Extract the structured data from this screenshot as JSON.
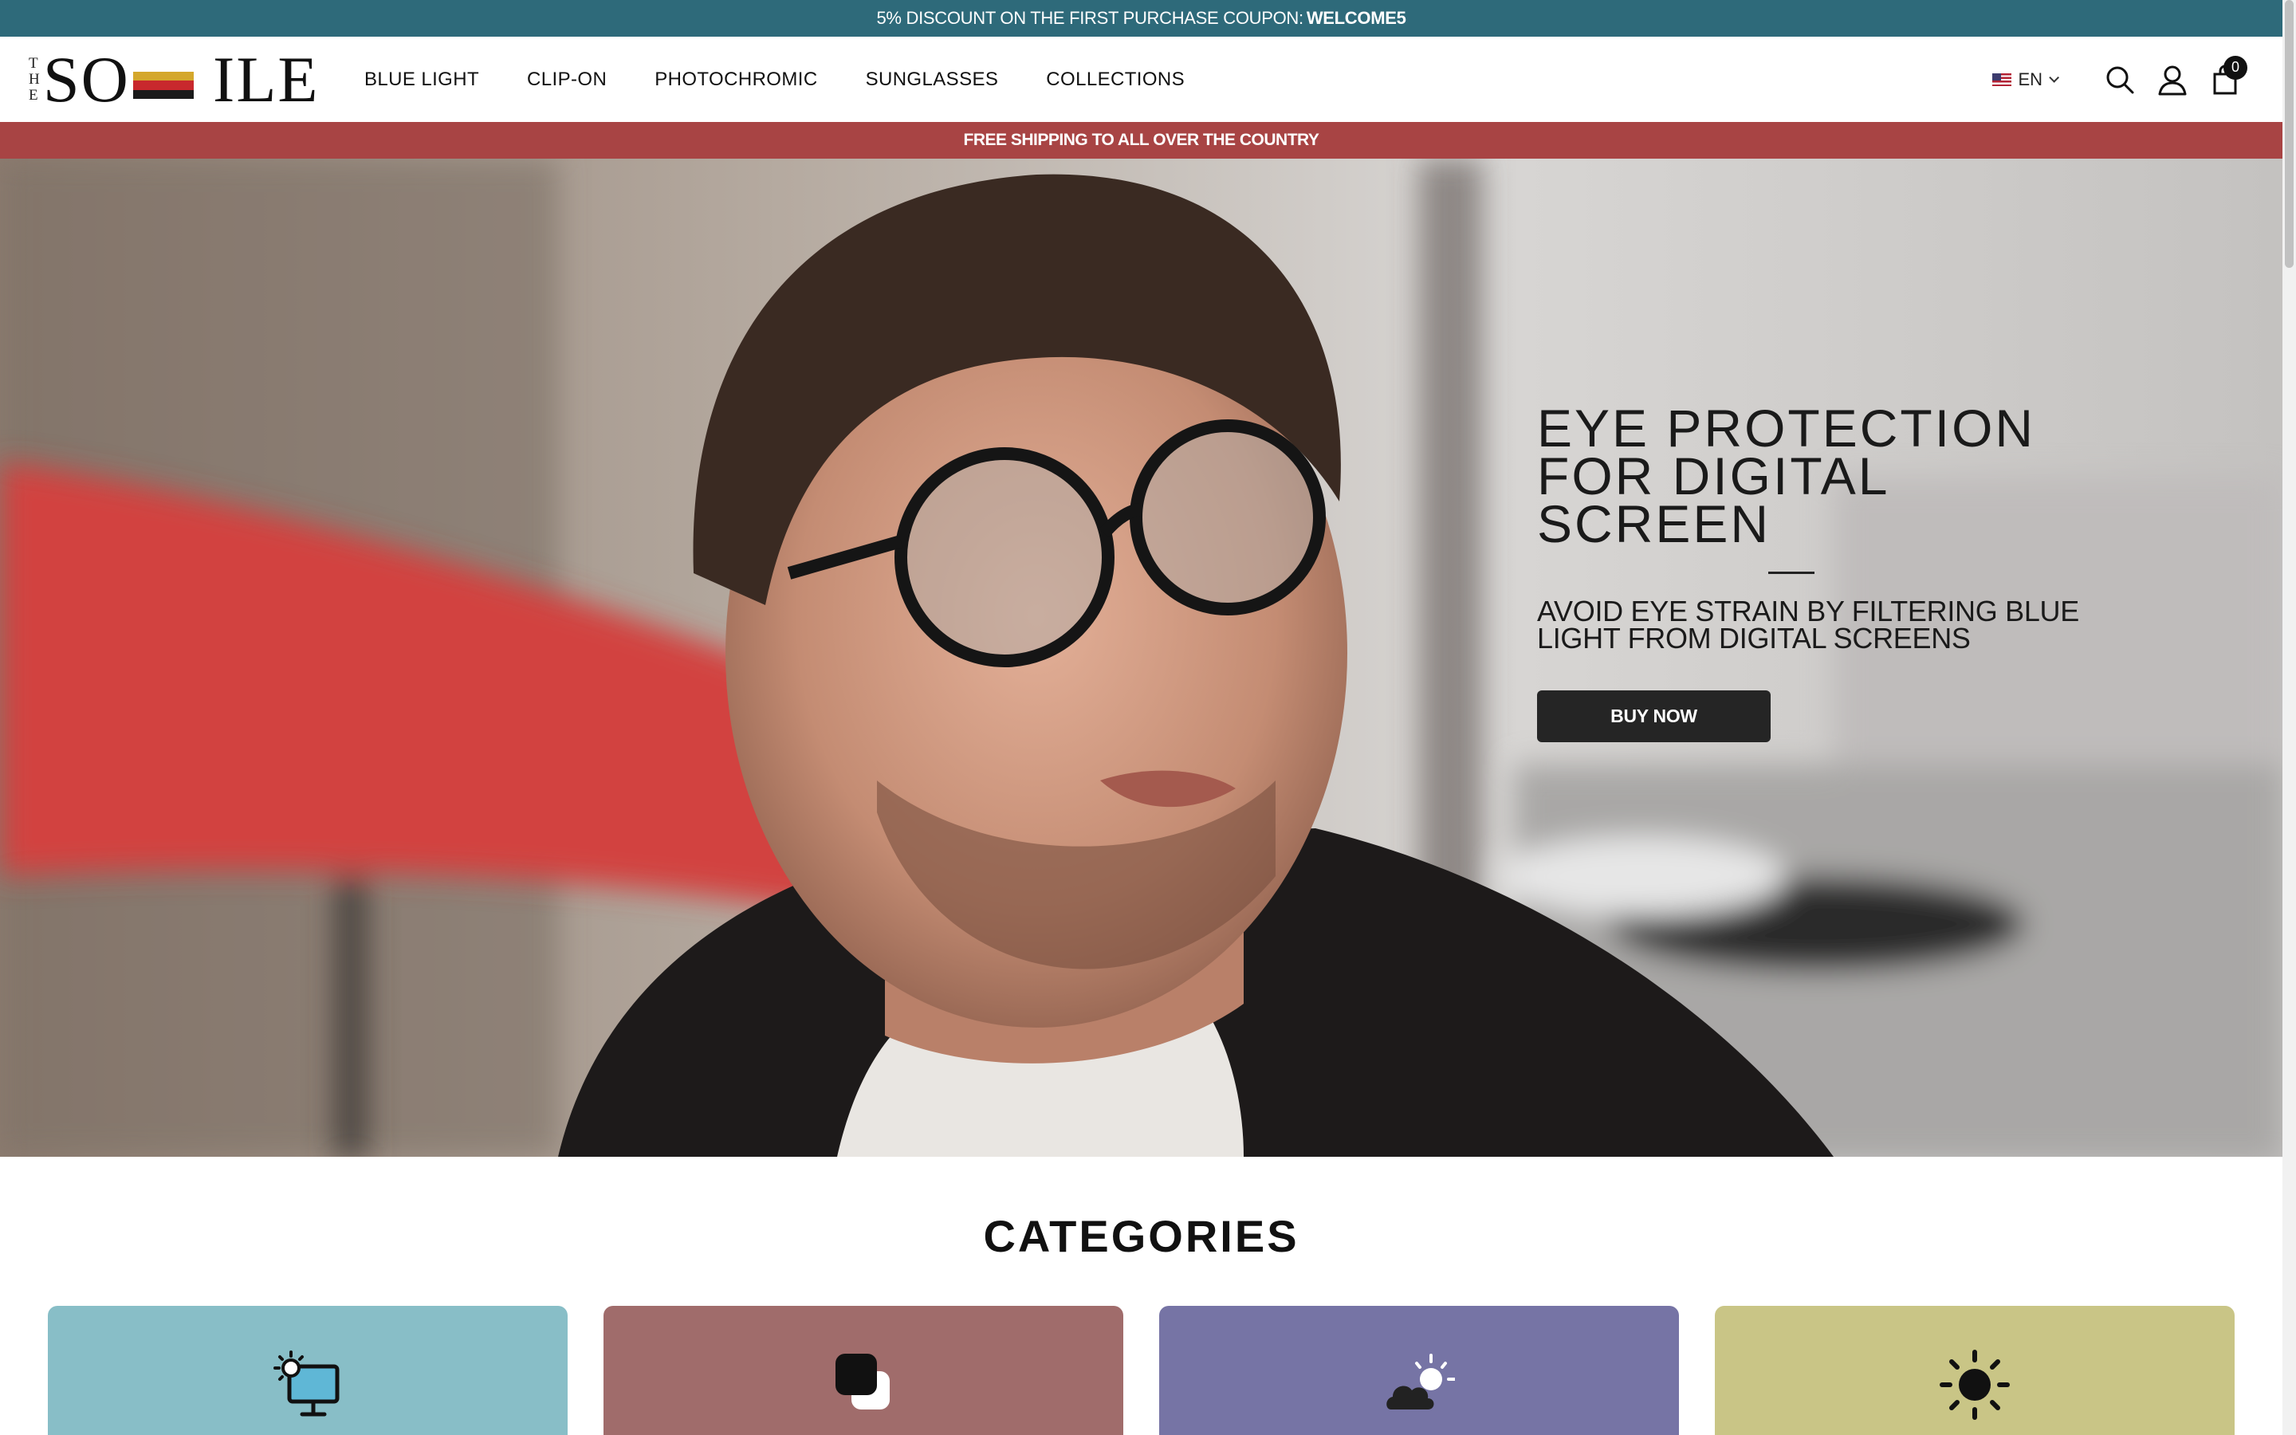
{
  "announcement": {
    "text": "5% DISCOUNT ON THE FIRST PURCHASE COUPON:",
    "coupon": "WELCOME5"
  },
  "header": {
    "logo": {
      "small": "THE",
      "word": "SOTTILE"
    },
    "nav": [
      "BLUE LIGHT",
      "CLIP-ON",
      "PHOTOCHROMIC",
      "SUNGLASSES",
      "COLLECTIONS"
    ],
    "language": "EN",
    "cart_count": "0",
    "icons": [
      "us-flag-icon",
      "chevron-down-icon",
      "search-icon",
      "user-icon",
      "cart-icon"
    ]
  },
  "shipping": {
    "text": "FREE SHIPPING TO ALL OVER THE COUNTRY"
  },
  "hero": {
    "title_lines": [
      "EYE PROTECTION",
      "FOR DIGITAL",
      "SCREEN"
    ],
    "subtitle_lines": [
      "AVOID EYE STRAIN BY FILTERING BLUE",
      "LIGHT FROM DIGITAL SCREENS"
    ],
    "button": "BUY NOW"
  },
  "categories": {
    "title": "CATEGORIES",
    "cards": [
      {
        "icon": "monitor-sun-icon",
        "color": "#88bec7"
      },
      {
        "icon": "layered-squares-icon",
        "color": "#a06c6b"
      },
      {
        "icon": "sun-cloud-icon",
        "color": "#7674a5"
      },
      {
        "icon": "sun-icon",
        "color": "#c9c586"
      }
    ]
  },
  "colors": {
    "topbar": "#2e6a7a",
    "shipbar": "#a84444",
    "button": "#252525",
    "logo_flag": [
      "#d4a72c",
      "#c8282d",
      "#1a1a1a"
    ]
  }
}
